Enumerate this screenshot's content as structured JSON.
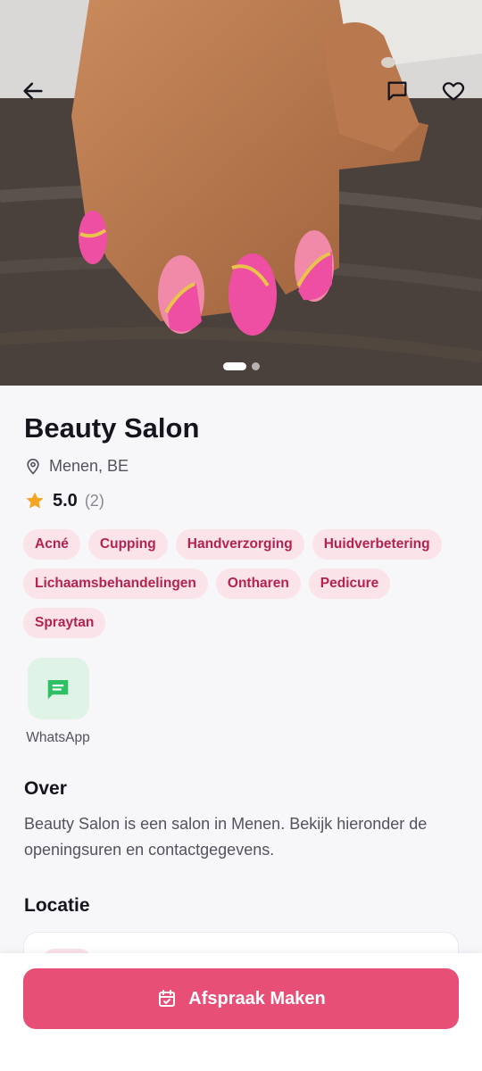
{
  "hero": {
    "image": "manicured-hand-pink-gold-nails",
    "slides": 2,
    "active_slide": 1,
    "back_icon": "arrow-left-icon",
    "chat_icon": "chat-bubble-icon",
    "favorite_icon": "heart-outline-icon"
  },
  "salon": {
    "name": "Beauty Salon",
    "location": "Menen, BE",
    "rating": "5.0",
    "review_count": "(2)"
  },
  "tags": [
    "Acné",
    "Cupping",
    "Handverzorging",
    "Huidverbetering",
    "Lichaamsbehandelingen",
    "Ontharen",
    "Pedicure",
    "Spraytan"
  ],
  "contact": {
    "whatsapp_label": "WhatsApp"
  },
  "about": {
    "heading": "Over",
    "text": "Beauty Salon is een salon in Menen. Bekijk hieronder de openingsuren en contactgegevens."
  },
  "location_section": {
    "heading": "Locatie"
  },
  "cta": {
    "label": "Afspraak Maken"
  },
  "colors": {
    "accent": "#e84f77",
    "tag_bg": "#fbe3ea",
    "tag_text": "#b3234f",
    "whatsapp_bg": "#dff3e7",
    "whatsapp_icon": "#2fbf64",
    "star": "#f5a524"
  }
}
